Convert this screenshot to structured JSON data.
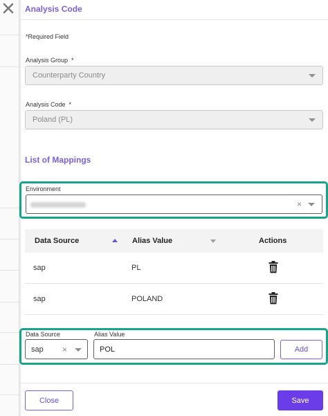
{
  "panel": {
    "title": "Analysis Code",
    "required_note": "*Required Field"
  },
  "analysis_group": {
    "label": "Analysis Group",
    "required_mark": "*",
    "value": "Counterparty Country"
  },
  "analysis_code": {
    "label": "Analysis Code",
    "required_mark": "*",
    "value": "Poland (PL)"
  },
  "mappings": {
    "title": "List of Mappings",
    "environment": {
      "label": "Environment",
      "value": "",
      "clear": "×"
    },
    "table": {
      "columns": [
        "Data Source",
        "Alias Value",
        "Actions"
      ],
      "rows": [
        {
          "data_source": "sap",
          "alias_value": "PL"
        },
        {
          "data_source": "sap",
          "alias_value": "POLAND"
        }
      ]
    },
    "add_row": {
      "data_source_label": "Data Source",
      "data_source_value": "sap",
      "alias_label": "Alias Value",
      "alias_value": "POL",
      "clear": "×",
      "add_label": "Add"
    }
  },
  "footer": {
    "close_label": "Close",
    "save_label": "Save"
  },
  "colors": {
    "accent": "#7a5fe0",
    "primary_button": "#6a3de8",
    "highlight": "#17a58a"
  },
  "icons": {
    "close": "close-icon",
    "delete": "trash-icon",
    "dropdown": "caret-down-icon",
    "sort": "sort-icon"
  }
}
